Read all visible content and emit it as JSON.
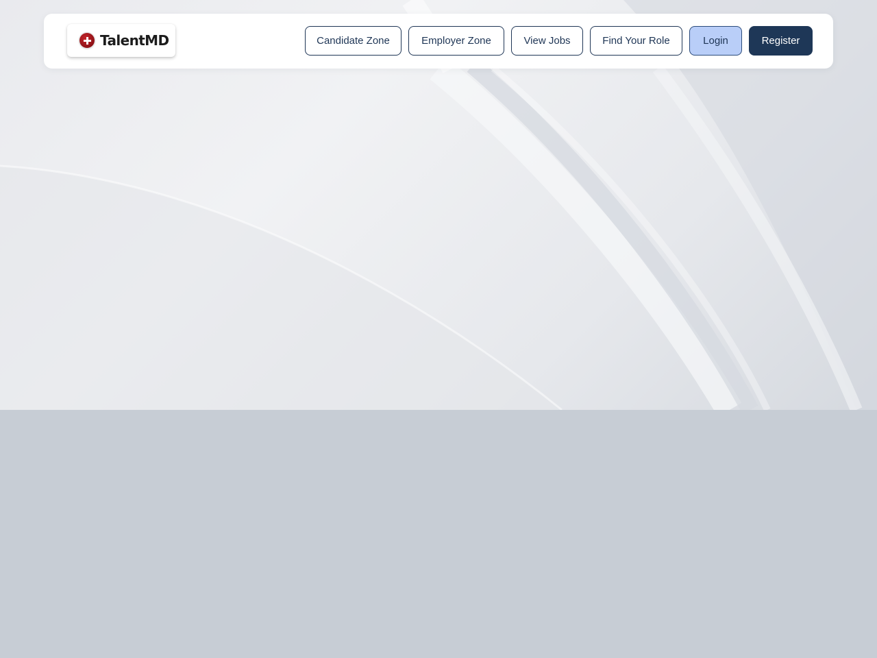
{
  "brand": {
    "logo_text": "TalentMD",
    "logo_icon": "medical-cross-icon",
    "logo_color": "#a0181d"
  },
  "nav": {
    "candidate_zone": "Candidate Zone",
    "employer_zone": "Employer Zone",
    "view_jobs": "View Jobs",
    "find_your_role": "Find Your Role",
    "login": "Login",
    "register": "Register"
  },
  "colors": {
    "primary": "#1e3757",
    "login_bg": "#b9cef8",
    "page_bg": "#c7cdd5"
  }
}
